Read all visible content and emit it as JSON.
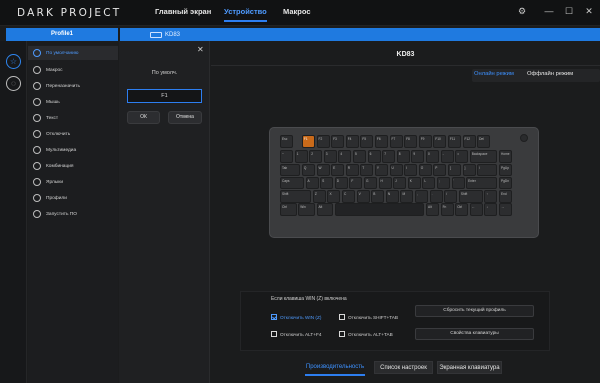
{
  "app": {
    "brand": "DARK PROJECT"
  },
  "nav": {
    "home": "Главный экран",
    "device": "Устройство",
    "macro": "Макрос"
  },
  "window": {
    "settings_icon": "gear-icon",
    "minimize_icon": "minimize-icon",
    "maximize_icon": "maximize-icon",
    "close_icon": "close-icon"
  },
  "profile": {
    "name": "Profile1"
  },
  "device_tab": {
    "label": "KD83"
  },
  "menu": {
    "items": [
      {
        "label": "По умолчанию"
      },
      {
        "label": "Макрос"
      },
      {
        "label": "Переназначить"
      },
      {
        "label": "Мышь"
      },
      {
        "label": "Текст"
      },
      {
        "label": "Отключить"
      },
      {
        "label": "Мультимедиа"
      },
      {
        "label": "Комбинация"
      },
      {
        "label": "Ярлыки"
      },
      {
        "label": "Профили"
      },
      {
        "label": "Запустить ПО"
      }
    ]
  },
  "dialog": {
    "title": "По умолч.",
    "field_value": "F1",
    "ok": "ОК",
    "cancel": "Отмена"
  },
  "main": {
    "title": "KD83",
    "online_mode": "Онлайн режим",
    "offline_mode": "Оффлайн режим"
  },
  "keyboard": {
    "rows": [
      [
        "Esc",
        "",
        "F1",
        "F2",
        "F3",
        "F4",
        "F5",
        "F6",
        "F7",
        "F8",
        "F9",
        "F10",
        "F11",
        "F12",
        "Del"
      ],
      [
        "~",
        "1",
        "2",
        "3",
        "4",
        "5",
        "6",
        "7",
        "8",
        "9",
        "0",
        "-",
        "=",
        "Backspace",
        "Home"
      ],
      [
        "Tab",
        "Q",
        "W",
        "E",
        "R",
        "T",
        "Y",
        "U",
        "I",
        "O",
        "P",
        "[",
        "]",
        "\\",
        "PgUp"
      ],
      [
        "Caps",
        "A",
        "S",
        "D",
        "F",
        "G",
        "H",
        "J",
        "K",
        "L",
        ";",
        "'",
        "Enter",
        "PgDn"
      ],
      [
        "Shift",
        "Z",
        "X",
        "C",
        "V",
        "B",
        "N",
        "M",
        ",",
        ".",
        "/",
        "Shift",
        "↑",
        "End"
      ],
      [
        "Ctrl",
        "Win",
        "Alt",
        "",
        "Alt",
        "Fn",
        "Ctrl",
        "←",
        "↓",
        "→"
      ]
    ]
  },
  "settings": {
    "title": "Если клавиша WIN (Z) включена",
    "disable_win": "Отключить WIN (Z)",
    "disable_shift_tab": "Отключить SHIFT+TAB",
    "disable_alt_f4": "Отключить ALT+F4",
    "disable_alt_tab": "Отключить ALT+TAB",
    "reset_profile": "Сбросить текущий профиль",
    "keyboard_props": "Свойства клавиатуры"
  },
  "bottom_tabs": {
    "performance": "Производительность",
    "settings_list": "Список настроек",
    "screen_keyboard": "Экранная клавиатура"
  },
  "colors": {
    "accent": "#1f7ae0",
    "active_text": "#4e9bff",
    "selected_key": "#c96a1a"
  }
}
